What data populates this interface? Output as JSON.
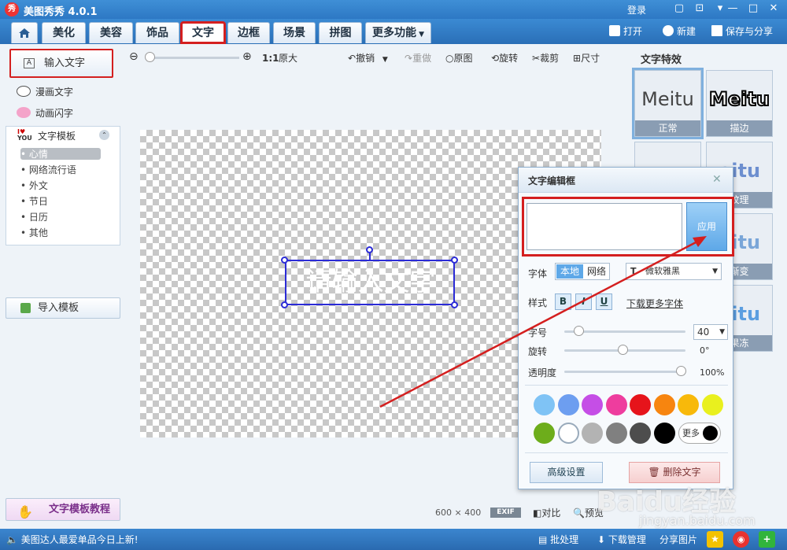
{
  "app": {
    "title": "美图秀秀 4.0.1",
    "logo_char": "秀"
  },
  "titlebar": {
    "login": "登录",
    "icons": [
      "message-icon",
      "skin-icon",
      "menu-icon",
      "minimize-icon",
      "maximize-icon",
      "close-icon"
    ]
  },
  "tabs": [
    {
      "label": "美化"
    },
    {
      "label": "美容"
    },
    {
      "label": "饰品"
    },
    {
      "label": "文字",
      "active": true
    },
    {
      "label": "边框"
    },
    {
      "label": "场景"
    },
    {
      "label": "拼图"
    },
    {
      "label": "更多功能"
    }
  ],
  "file_actions": {
    "open": "打开",
    "new": "新建",
    "save_share": "保存与分享"
  },
  "sidebar": {
    "input_text": "输入文字",
    "comic_text": "漫画文字",
    "animated_text": "动画闪字",
    "templates_title": "文字模板",
    "template_items": [
      "心情",
      "网络流行语",
      "外文",
      "节日",
      "日历",
      "其他"
    ],
    "import_template": "导入模板",
    "tutorial": "文字模板教程"
  },
  "toolbar": {
    "zoom_ratio": "1:1",
    "original_size": "原大",
    "undo": "撤销",
    "redo": "重做",
    "original": "原图",
    "rotate": "旋转",
    "crop": "裁剪",
    "size": "尺寸"
  },
  "canvas": {
    "placeholder_text": "请输入文字"
  },
  "effects": {
    "title": "文字特效",
    "items": [
      {
        "preview": "Meitu",
        "label": "正常"
      },
      {
        "preview": "Meitu",
        "label": "描边"
      },
      {
        "preview": "",
        "label": ""
      },
      {
        "preview": "eitu",
        "label": "纹理"
      },
      {
        "preview": "",
        "label": ""
      },
      {
        "preview": "eitu",
        "label": "渐变"
      },
      {
        "preview": "",
        "label": ""
      },
      {
        "preview": "eitu",
        "label": "果冻"
      }
    ]
  },
  "dialog": {
    "title": "文字编辑框",
    "apply": "应用",
    "font_label": "字体",
    "font_source_local": "本地",
    "font_source_web": "网络",
    "font_name": "微软雅黑",
    "style_label": "样式",
    "bold": "B",
    "italic": "I",
    "underline": "U",
    "download_fonts": "下载更多字体",
    "size_label": "字号",
    "size_value": "40",
    "size_slider": 0.12,
    "rotate_label": "旋转",
    "rotate_value": "0°",
    "rotate_slider": 0.5,
    "opacity_label": "透明度",
    "opacity_value": "100%",
    "opacity_slider": 1.0,
    "colors_row1": [
      "#7fc3f5",
      "#6d9ef0",
      "#c54ee6",
      "#ee3d9e",
      "#e6141b",
      "#f7850f",
      "#f8b90a",
      "#e9f01e"
    ],
    "colors_row2": [
      "#6dad1b",
      "#ffffff",
      "#b3b3b3",
      "#808080",
      "#4d4d4d",
      "#000000"
    ],
    "more_colors": "更多",
    "advanced": "高级设置",
    "delete_text": "删除文字"
  },
  "footer": {
    "dimensions_w": "600",
    "dimensions_x": "×",
    "dimensions_h": "400",
    "exif": "EXIF",
    "compare": "对比",
    "preview": "预览"
  },
  "statusbar": {
    "news": "美图达人最爱单品今日上新!",
    "batch": "批处理",
    "download_mgr": "下载管理",
    "share": "分享图片"
  },
  "watermark": {
    "brand": "Baidu经验",
    "url": "jingyan.baidu.com"
  }
}
